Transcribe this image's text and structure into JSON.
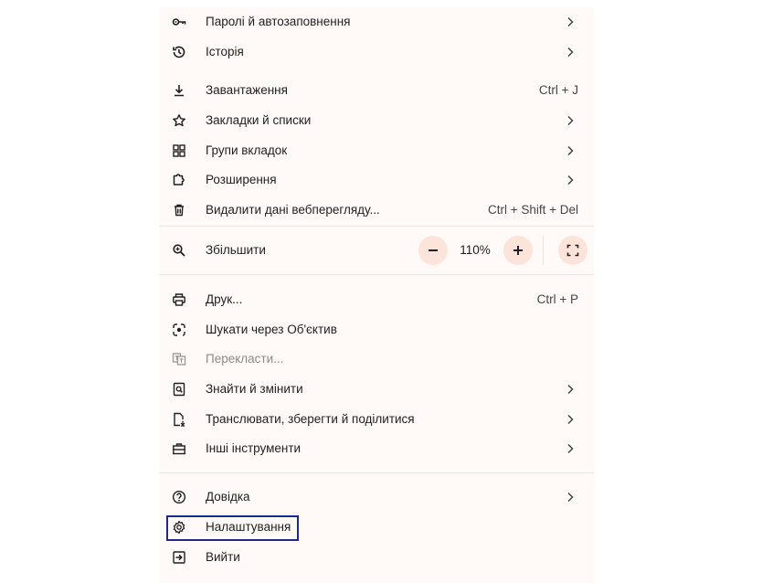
{
  "menu": {
    "items": [
      {
        "label": "Паролі й автозаповнення",
        "icon": "key-icon",
        "shortcut": "",
        "submenu": true
      },
      {
        "label": "Історія",
        "icon": "history-icon",
        "shortcut": "",
        "submenu": true
      },
      {
        "label": "Завантаження",
        "icon": "download-icon",
        "shortcut": "Ctrl + J",
        "submenu": false
      },
      {
        "label": "Закладки й списки",
        "icon": "star-icon",
        "shortcut": "",
        "submenu": true
      },
      {
        "label": "Групи вкладок",
        "icon": "tab-groups-icon",
        "shortcut": "",
        "submenu": true
      },
      {
        "label": "Розширення",
        "icon": "extension-icon",
        "shortcut": "",
        "submenu": true
      },
      {
        "label": "Видалити дані вебперегляду...",
        "icon": "trash-icon",
        "shortcut": "Ctrl + Shift + Del",
        "submenu": false
      }
    ],
    "zoom": {
      "label": "Збільшити",
      "value": "110%",
      "minus": "−",
      "plus": "+"
    },
    "tools": [
      {
        "label": "Друк...",
        "icon": "print-icon",
        "shortcut": "Ctrl + P",
        "submenu": false
      },
      {
        "label": "Шукати через Об'єктив",
        "icon": "lens-icon",
        "shortcut": "",
        "submenu": false
      },
      {
        "label": "Перекласти...",
        "icon": "translate-icon",
        "shortcut": "",
        "submenu": false,
        "disabled": true
      },
      {
        "label": "Знайти й змінити",
        "icon": "find-icon",
        "shortcut": "",
        "submenu": true
      },
      {
        "label": "Транслювати, зберегти й поділитися",
        "icon": "cast-save-icon",
        "shortcut": "",
        "submenu": true
      },
      {
        "label": "Інші інструменти",
        "icon": "toolbox-icon",
        "shortcut": "",
        "submenu": true
      }
    ],
    "bottom": [
      {
        "label": "Довідка",
        "icon": "help-icon",
        "submenu": true
      },
      {
        "label": "Налаштування",
        "icon": "settings-icon",
        "submenu": false,
        "highlighted": true
      },
      {
        "label": "Вийти",
        "icon": "exit-icon",
        "submenu": false
      }
    ]
  },
  "colors": {
    "menu_background": "#fff9f8",
    "zoom_button": "#fde4da",
    "highlight_border": "#1a2a8c",
    "separator": "#f0e2dd"
  }
}
